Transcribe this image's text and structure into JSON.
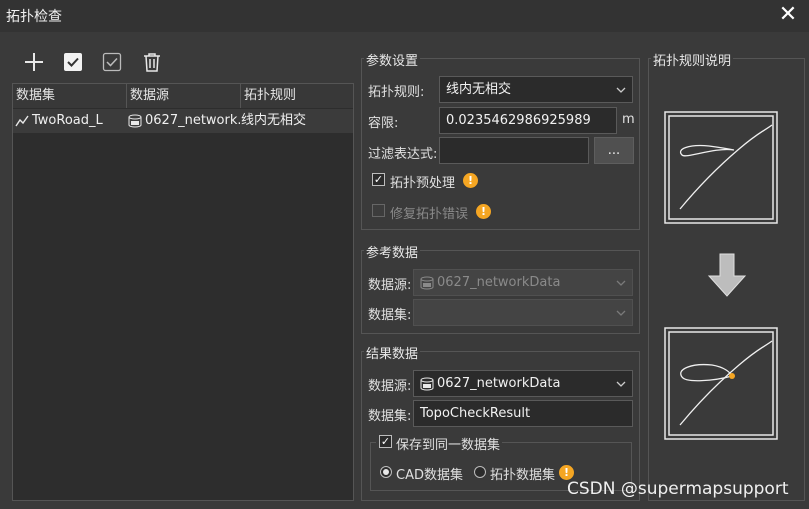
{
  "window": {
    "title": "拓扑检查",
    "close_glyph": "✕"
  },
  "toolbar": {
    "add": "add-icon",
    "select_all": "select-all-icon",
    "select_invert": "select-invert-icon",
    "delete": "delete-icon"
  },
  "table": {
    "columns": [
      "数据集",
      "数据源",
      "拓扑规则"
    ],
    "rows": [
      {
        "dataset": "TwoRoad_L",
        "datasource": "0627_network...",
        "rule": "线内无相交"
      }
    ]
  },
  "params": {
    "legend": "参数设置",
    "rule_label": "拓扑规则:",
    "rule_value": "线内无相交",
    "tolerance_label": "容限:",
    "tolerance_value": "0.0235462986925989",
    "tolerance_unit": "m",
    "filter_label": "过滤表达式:",
    "filter_value": "",
    "filter_button": "...",
    "preprocess_label": "拓扑预处理",
    "repair_label": "修复拓扑错误",
    "warn_glyph": "!"
  },
  "reference": {
    "legend": "参考数据",
    "source_label": "数据源:",
    "source_value": "0627_networkData",
    "dataset_label": "数据集:",
    "dataset_value": ""
  },
  "result": {
    "legend": "结果数据",
    "source_label": "数据源:",
    "source_value": "0627_networkData",
    "dataset_label": "数据集:",
    "dataset_value": "TopoCheckResult",
    "save_same_label": "保存到同一数据集",
    "cad_label": "CAD数据集",
    "topo_label": "拓扑数据集"
  },
  "rule_desc": {
    "legend": "拓扑规则说明"
  },
  "watermark": "CSDN @supermapsupport",
  "colors": {
    "warn": "#f5a623",
    "background": "#3a3a3a",
    "field": "#2b2b2b"
  }
}
